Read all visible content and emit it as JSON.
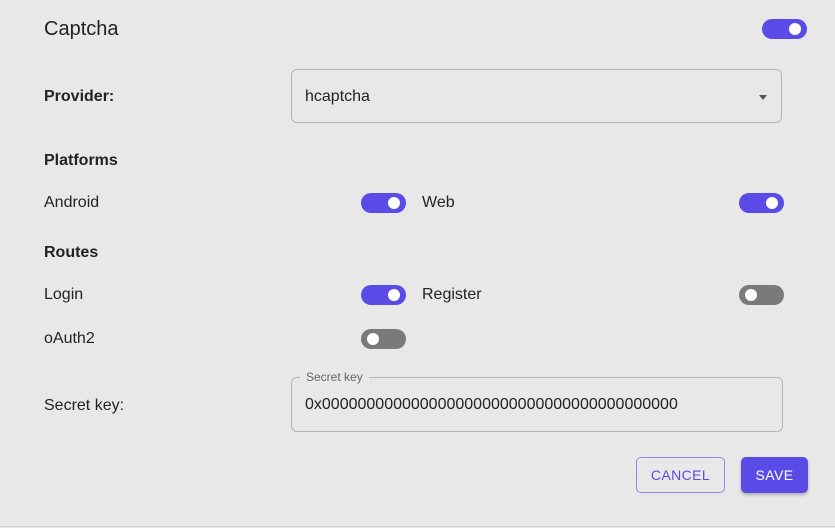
{
  "header": {
    "title": "Captcha",
    "enabled": true
  },
  "provider": {
    "label": "Provider:",
    "value": "hcaptcha"
  },
  "platforms": {
    "heading": "Platforms",
    "items": [
      {
        "label": "Android",
        "enabled": true
      },
      {
        "label": "Web",
        "enabled": true
      }
    ]
  },
  "routes": {
    "heading": "Routes",
    "items": [
      {
        "label": "Login",
        "enabled": true
      },
      {
        "label": "Register",
        "enabled": false
      },
      {
        "label": "oAuth2",
        "enabled": false
      }
    ]
  },
  "secret": {
    "label": "Secret key:",
    "field_label": "Secret key",
    "value": "0x0000000000000000000000000000000000000000"
  },
  "actions": {
    "cancel_label": "CANCEL",
    "save_label": "SAVE"
  },
  "colors": {
    "accent": "#5b4be6",
    "toggle_off": "#7a7a7a",
    "background": "#e8e8e8"
  }
}
